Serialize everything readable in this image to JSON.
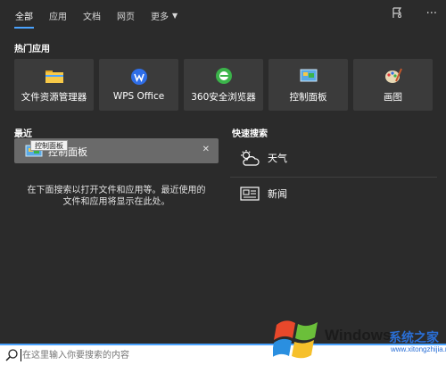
{
  "tabs": [
    {
      "label": "全部"
    },
    {
      "label": "应用"
    },
    {
      "label": "文档"
    },
    {
      "label": "网页"
    },
    {
      "label": "更多"
    }
  ],
  "hot_apps": {
    "title": "热门应用",
    "items": [
      {
        "label": "文件资源管理器",
        "icon": "folder-icon"
      },
      {
        "label": "WPS Office",
        "icon": "wps-icon"
      },
      {
        "label": "360安全浏览器",
        "icon": "browser-360-icon"
      },
      {
        "label": "控制面板",
        "icon": "control-panel-icon"
      },
      {
        "label": "画图",
        "icon": "paint-icon"
      }
    ]
  },
  "recent": {
    "title": "最近",
    "item_label": "控制面板",
    "tooltip": "控制面板",
    "hint_line1": "在下面搜索以打开文件和应用等。最近使用的",
    "hint_line2": "文件和应用将显示在此处。"
  },
  "quick_search": {
    "title": "快速搜索",
    "items": [
      {
        "label": "天气",
        "icon": "weather-icon"
      },
      {
        "label": "新闻",
        "icon": "news-icon"
      }
    ]
  },
  "search": {
    "placeholder": "在这里输入你要搜索的内容"
  },
  "watermark": {
    "brand": "Windows",
    "cn": "系统之家",
    "url": "www.xitongzhijia.net"
  },
  "colors": {
    "background": "#2b2b2b",
    "tile": "#3b3b3b",
    "accent": "#4aa3ff"
  }
}
